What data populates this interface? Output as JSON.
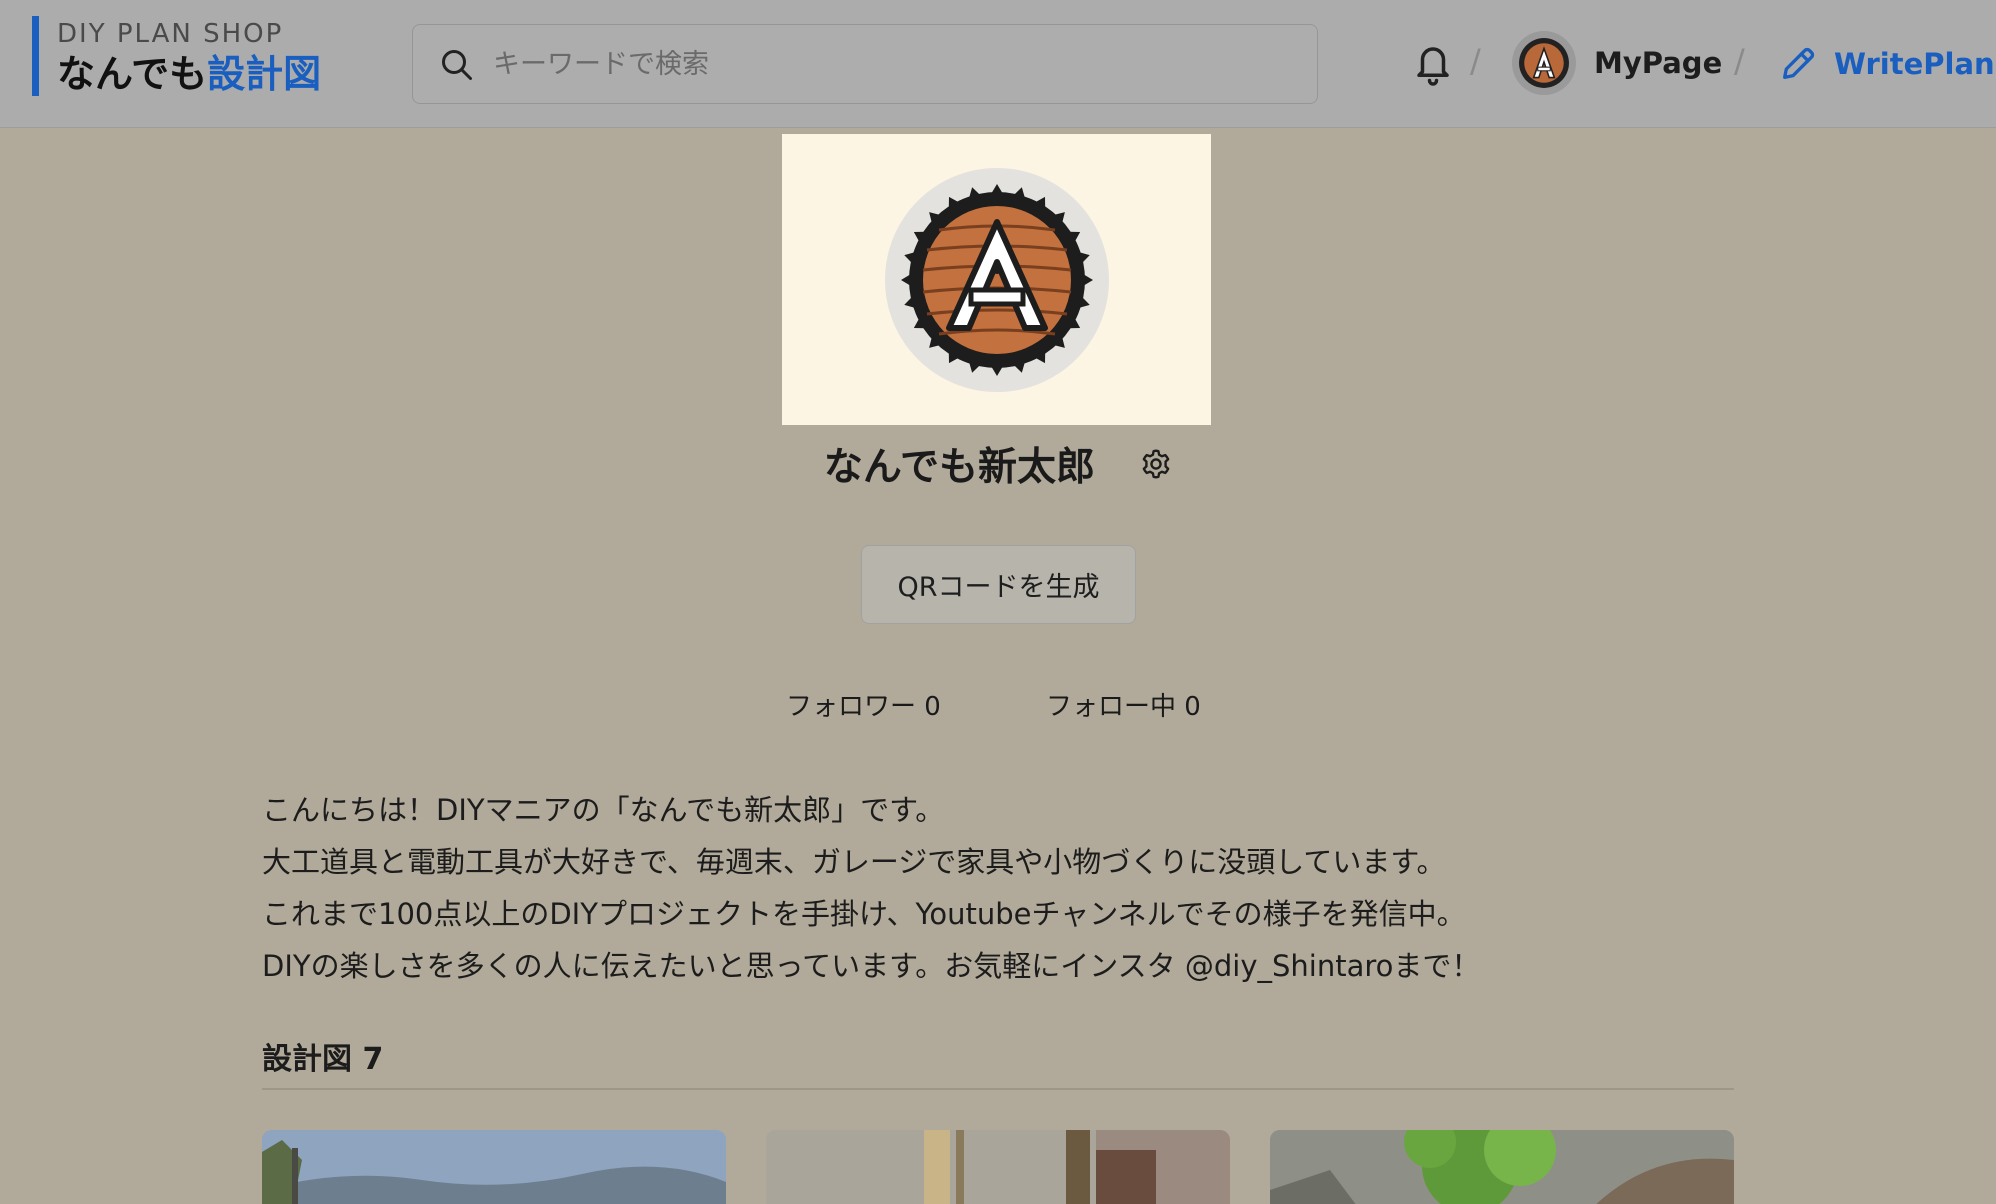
{
  "header": {
    "logo_sub": "DIY PLAN SHOP",
    "logo_main": "なんでも",
    "logo_accent": "設計図",
    "search_placeholder": "キーワードで検索",
    "separator": "/",
    "mypage_label": "MyPage",
    "writeplan_label": "WritePlan"
  },
  "profile": {
    "name": "なんでも新太郎",
    "qr_button_label": "QRコードを生成",
    "followers_label": "フォロワー 0",
    "following_label": "フォロー中 0",
    "bio_lines": [
      "こんにちは！DIYマニアの「なんでも新太郎」です。",
      "大工道具と電動工具が大好きで、毎週末、ガレージで家具や小物づくりに没頭しています。",
      "これまで100点以上のDIYプロジェクトを手掛け、Youtubeチャンネルでその様子を発信中。",
      "DIYの楽しさを多くの人に伝えたいと思っています。お気軽にインスタ @diy_Shintaroまで！"
    ]
  },
  "plans": {
    "title": "設計図 7"
  },
  "colors": {
    "accent": "#1a5fbf",
    "header_bg": "#acacac",
    "page_bg": "#b1aa9a",
    "profile_image_bg": "#fdf5e3"
  },
  "icons": {
    "search": "search-icon",
    "bell": "bell-icon",
    "pencil": "pencil-icon",
    "gear": "gear-icon",
    "avatar": "saw-blade-a-logo"
  }
}
